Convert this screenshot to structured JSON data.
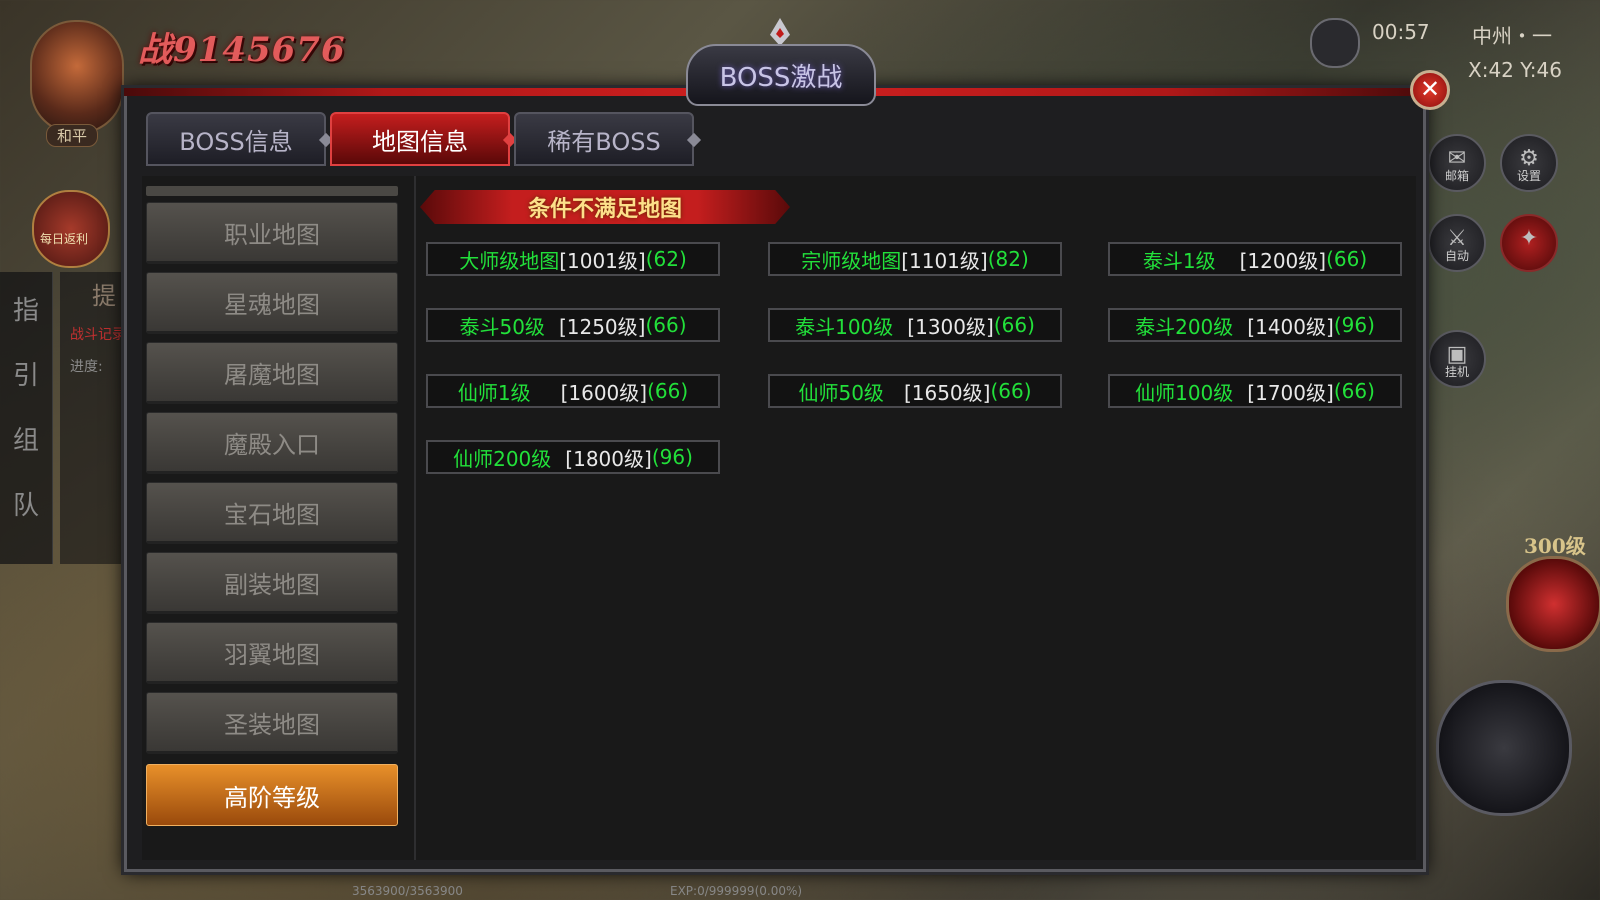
{
  "hud": {
    "power": "战9145676",
    "peace": "和平",
    "daily": "每日返利",
    "clock": "00:57",
    "location": "中州・一",
    "coords": "X:42 Y:46",
    "side_chars": [
      "指",
      "引",
      "组",
      "队"
    ],
    "tip_title": "提",
    "tip_line1": "战斗记录",
    "tip_line2": "进度:",
    "mail": "邮箱",
    "settings": "设置",
    "auto": "自动",
    "hangup": "挂机",
    "level_300": "300级",
    "exp": "EXP:0/999999(0.00%)",
    "hp": "3563900/3563900"
  },
  "dialog": {
    "title": "BOSS激战",
    "close_glyph": "✕",
    "tabs": [
      {
        "label": "BOSS信息",
        "active": false
      },
      {
        "label": "地图信息",
        "active": true
      },
      {
        "label": "稀有BOSS",
        "active": false
      }
    ],
    "nav": [
      {
        "label": "职业地图",
        "active": false
      },
      {
        "label": "星魂地图",
        "active": false
      },
      {
        "label": "屠魔地图",
        "active": false
      },
      {
        "label": "魔殿入口",
        "active": false
      },
      {
        "label": "宝石地图",
        "active": false
      },
      {
        "label": "副装地图",
        "active": false
      },
      {
        "label": "羽翼地图",
        "active": false
      },
      {
        "label": "圣装地图",
        "active": false
      },
      {
        "label": "高阶等级",
        "active": true
      }
    ],
    "section_title": "条件不满足地图",
    "maps": [
      {
        "name": "大师级地图",
        "level": "[1001级]",
        "count": "(62)"
      },
      {
        "name": "宗师级地图",
        "level": "[1101级]",
        "count": "(82)"
      },
      {
        "name": "泰斗1级",
        "level": "[1200级]",
        "count": "(66)"
      },
      {
        "name": "泰斗50级",
        "level": "[1250级]",
        "count": "(66)"
      },
      {
        "name": "泰斗100级",
        "level": "[1300级]",
        "count": "(66)"
      },
      {
        "name": "泰斗200级",
        "level": "[1400级]",
        "count": "(96)"
      },
      {
        "name": "仙师1级",
        "level": "[1600级]",
        "count": "(66)"
      },
      {
        "name": "仙师50级",
        "level": "[1650级]",
        "count": "(66)"
      },
      {
        "name": "仙师100级",
        "level": "[1700级]",
        "count": "(66)"
      },
      {
        "name": "仙师200级",
        "level": "[1800级]",
        "count": "(96)"
      }
    ]
  },
  "colors": {
    "accent_red": "#c41e1e",
    "map_name_green": "#22e03a",
    "active_nav_orange": "#e8902a",
    "banner_text": "#fde08a"
  }
}
